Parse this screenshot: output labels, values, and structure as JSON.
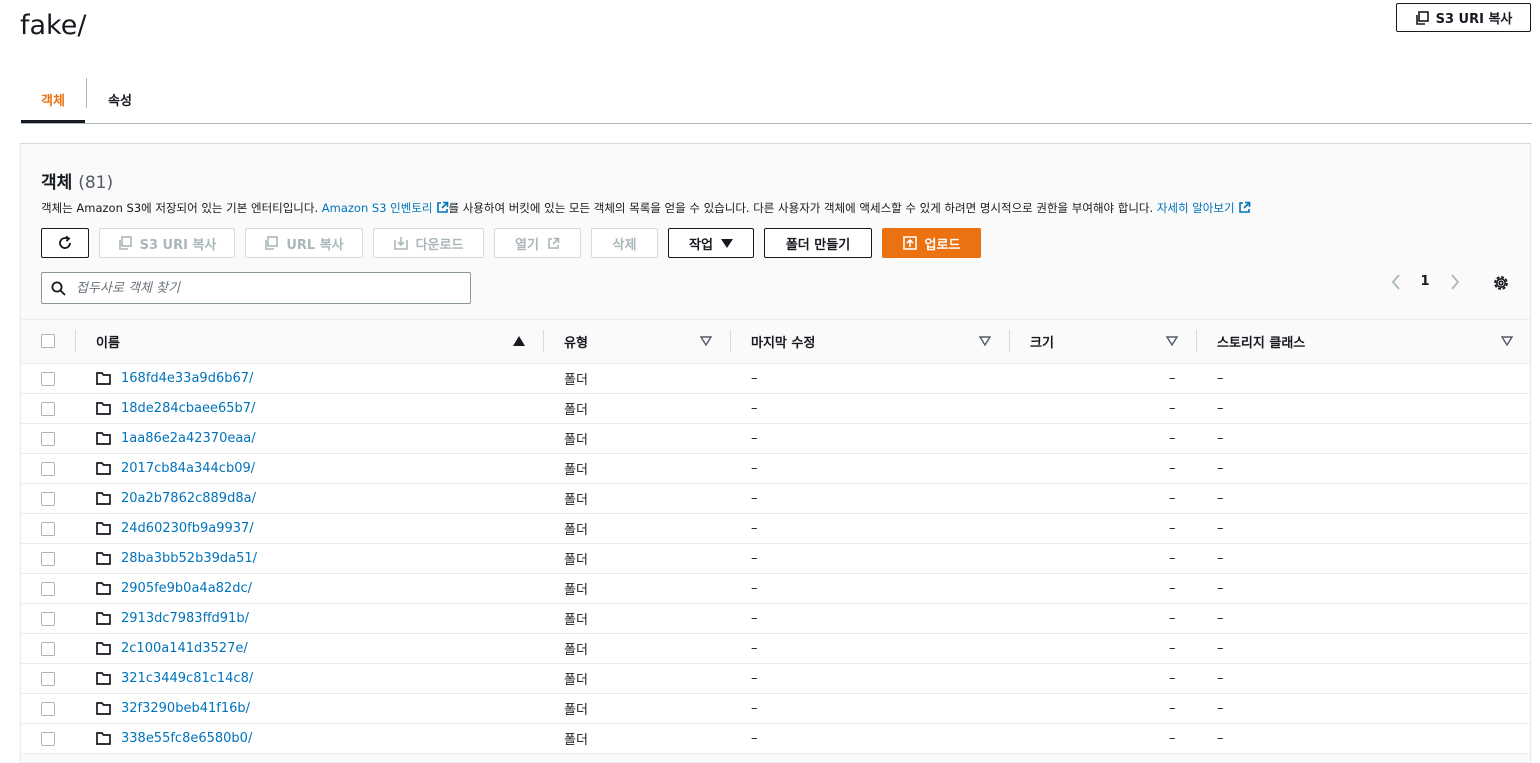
{
  "page": {
    "title": "fake/",
    "copy_s3_uri_label": "S3 URI 복사"
  },
  "tabs": [
    {
      "label": "객체",
      "active": true
    },
    {
      "label": "속성",
      "active": false
    }
  ],
  "objects_panel": {
    "title": "객체",
    "count": "(81)",
    "description_1": "객체는 Amazon S3에 저장되어 있는 기본 엔터티입니다. ",
    "inventory_link": "Amazon S3 인벤토리",
    "description_2": "를 사용하여 버킷에 있는 모든 객체의 목록을 얻을 수 있습니다. 다른 사용자가 객체에 액세스할 수 있게 하려면 명시적으로 권한을 부여해야 합니다. ",
    "learn_more_link": "자세히 알아보기"
  },
  "toolbar": {
    "copy_s3_uri": "S3 URI 복사",
    "copy_url": "URL 복사",
    "download": "다운로드",
    "open": "열기",
    "delete": "삭제",
    "actions": "작업",
    "create_folder": "폴더 만들기",
    "upload": "업로드"
  },
  "search": {
    "placeholder": "접두사로 객체 찾기"
  },
  "pagination": {
    "current_page": "1"
  },
  "table": {
    "columns": {
      "name": "이름",
      "type": "유형",
      "last_modified": "마지막 수정",
      "size": "크기",
      "storage_class": "스토리지 클래스"
    },
    "rows": [
      {
        "name": "168fd4e33a9d6b67/",
        "type": "폴더",
        "last_modified": "–",
        "size": "–",
        "storage_class": "–"
      },
      {
        "name": "18de284cbaee65b7/",
        "type": "폴더",
        "last_modified": "–",
        "size": "–",
        "storage_class": "–"
      },
      {
        "name": "1aa86e2a42370eaa/",
        "type": "폴더",
        "last_modified": "–",
        "size": "–",
        "storage_class": "–"
      },
      {
        "name": "2017cb84a344cb09/",
        "type": "폴더",
        "last_modified": "–",
        "size": "–",
        "storage_class": "–"
      },
      {
        "name": "20a2b7862c889d8a/",
        "type": "폴더",
        "last_modified": "–",
        "size": "–",
        "storage_class": "–"
      },
      {
        "name": "24d60230fb9a9937/",
        "type": "폴더",
        "last_modified": "–",
        "size": "–",
        "storage_class": "–"
      },
      {
        "name": "28ba3bb52b39da51/",
        "type": "폴더",
        "last_modified": "–",
        "size": "–",
        "storage_class": "–"
      },
      {
        "name": "2905fe9b0a4a82dc/",
        "type": "폴더",
        "last_modified": "–",
        "size": "–",
        "storage_class": "–"
      },
      {
        "name": "2913dc7983ffd91b/",
        "type": "폴더",
        "last_modified": "–",
        "size": "–",
        "storage_class": "–"
      },
      {
        "name": "2c100a141d3527e/",
        "type": "폴더",
        "last_modified": "–",
        "size": "–",
        "storage_class": "–"
      },
      {
        "name": "321c3449c81c14c8/",
        "type": "폴더",
        "last_modified": "–",
        "size": "–",
        "storage_class": "–"
      },
      {
        "name": "32f3290beb41f16b/",
        "type": "폴더",
        "last_modified": "–",
        "size": "–",
        "storage_class": "–"
      },
      {
        "name": "338e55fc8e6580b0/",
        "type": "폴더",
        "last_modified": "–",
        "size": "–",
        "storage_class": "–"
      }
    ]
  }
}
